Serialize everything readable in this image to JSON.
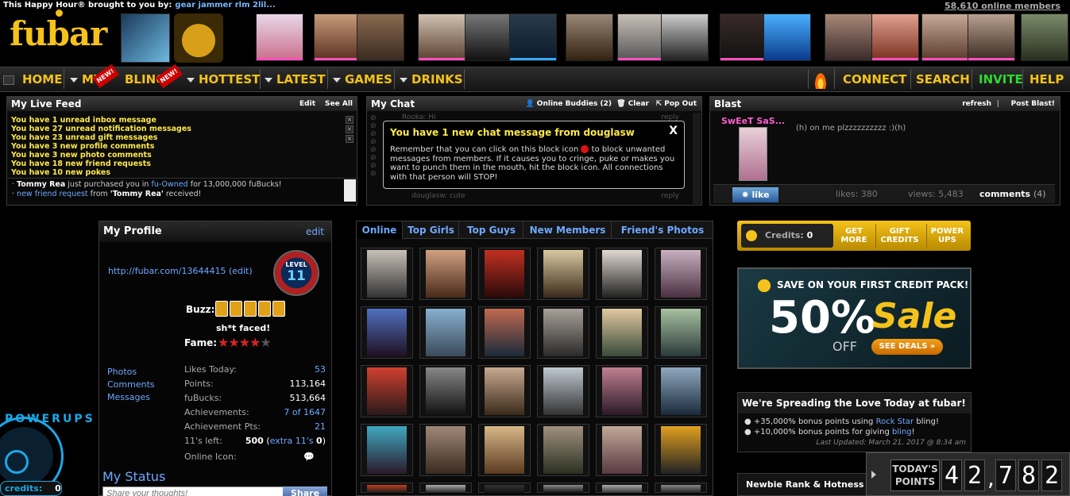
{
  "header": {
    "sponsor_prefix": "This Happy Hour® brought to you by:",
    "sponsor_user": "gear jammer rlm 2lil...",
    "online_members": "58,610 online members",
    "logo_text": "fubar"
  },
  "nav": {
    "home": "HOME",
    "my": "MY",
    "bling": "BLING",
    "hottest": "HOTTEST",
    "latest": "LATEST",
    "games": "GAMES",
    "drinks": "DRINKS",
    "connect": "CONNECT",
    "search": "SEARCH",
    "invite": "INVITE",
    "help": "HELP",
    "new_badge": "NEW!"
  },
  "live_feed": {
    "title": "My Live Feed",
    "edit": "Edit",
    "see_all": "See All",
    "notices": [
      "You have 1 unread inbox message",
      "You have 27 unread notification messages",
      "You have 23 unread gift messages",
      "You have 3 new profile comments",
      "You have 3 new photo comments",
      "You have 18 new friend requests",
      "You have 10 new pokes"
    ],
    "activity1_user": "Tommy Rea",
    "activity1_mid": "just purchased you in",
    "activity1_link": "fu-Owned",
    "activity1_end": "for 13,000,000 fuBucks!",
    "activity2_link": "new friend request",
    "activity2_mid": "from",
    "activity2_user": "'Tommy Rea'",
    "activity2_end": "received!"
  },
  "chat": {
    "title": "My Chat",
    "online_buddies": "Online Buddies (2)",
    "clear": "Clear",
    "pop_out": "Pop Out",
    "bg_user1": "Rooka: Hi",
    "bg_user2": "douglasw: cute",
    "reply": "reply",
    "popup_title": "You have 1 new chat message from douglasw",
    "popup_close": "X",
    "popup_body_a": "Remember that you can click on this block icon",
    "popup_body_b": "to block unwanted messages from members. If it causes you to cringe, puke or makes you want to punch them in the mouth, hit the block icon. All connections with that person will STOP!"
  },
  "blast": {
    "title": "Blast",
    "refresh": "refresh",
    "post": "Post Blast!",
    "user": "SwEeT SaS...",
    "message": "(h) on me plzzzzzzzzzz :)(h)",
    "like": "like",
    "likes": "likes: 380",
    "views": "views: 5,483",
    "comments": "comments",
    "comments_count": "(4)"
  },
  "profile": {
    "title": "My Profile",
    "edit": "edit",
    "url": "http://fubar.com/13644415 (edit)",
    "level_label": "LEVEL",
    "level": "11",
    "buzz_label": "Buzz:",
    "buzz_status": "sh*t faced!",
    "fame_label": "Fame:",
    "fame_stars": 4,
    "links": [
      "Photos",
      "Comments",
      "Messages"
    ],
    "stats": [
      {
        "label": "Likes Today:",
        "value": "53",
        "link": true
      },
      {
        "label": "Points:",
        "value": "113,164",
        "link": false
      },
      {
        "label": "fuBucks:",
        "value": "513,664",
        "link": false
      },
      {
        "label": "Achievements:",
        "value": "7 of 1647",
        "link": true
      },
      {
        "label": "Achievement Pts:",
        "value": "21",
        "link": true
      },
      {
        "label": "11's left:",
        "value": "500",
        "extra": "extra 11's",
        "extra_tail": "0",
        "link": false
      },
      {
        "label": "Online Icon:",
        "value": "",
        "link": false
      }
    ],
    "status_title": "My Status",
    "status_placeholder": "Share your thoughts!",
    "share": "Share"
  },
  "powerups": {
    "label": "POWERUPS",
    "credits_label": "credits:",
    "credits_value": "0"
  },
  "photos": {
    "tabs": [
      "Online",
      "Top Girls",
      "Top Guys",
      "New Members",
      "Friend's Photos"
    ]
  },
  "credits_bar": {
    "label": "Credits:",
    "value": "0",
    "get_more": "GET MORE",
    "gift": "GIFT CREDITS",
    "power": "POWER UPS"
  },
  "sale": {
    "headline": "SAVE ON YOUR FIRST CREDIT PACK!",
    "percent": "50%",
    "off": "OFF",
    "sale": "Sale",
    "see_deals": "SEE DEALS"
  },
  "love": {
    "title": "We're Spreading the Love Today at fubar!",
    "line1_a": "+35,000% bonus points using",
    "line1_link": "Rock Star",
    "line1_b": "bling!",
    "line2_a": "+10,000% bonus points for giving",
    "line2_link": "bling",
    "line2_b": "!",
    "updated": "Last Updated: March 21, 2017 @ 8:34 am"
  },
  "newbie": {
    "title": "Newbie Rank & Hotness"
  },
  "todays_points": {
    "label1": "TODAY'S",
    "label2": "POINTS",
    "digits": [
      "4",
      "2",
      ",",
      "7",
      "8",
      "2"
    ]
  }
}
